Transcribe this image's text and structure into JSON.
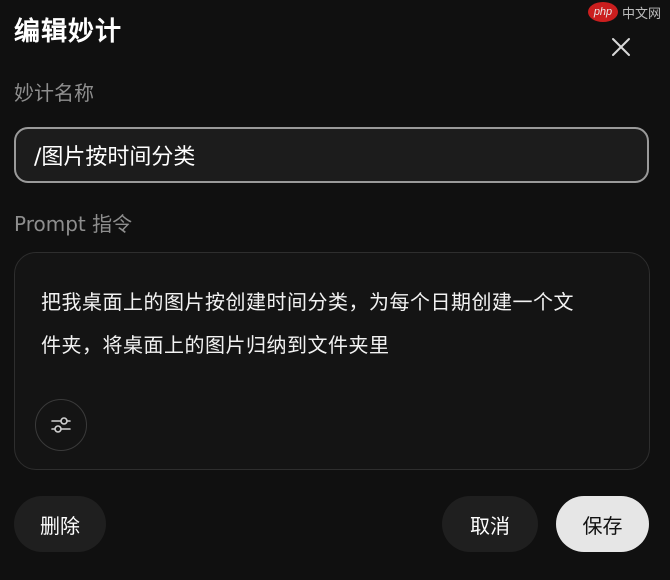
{
  "dialog": {
    "title": "编辑妙计"
  },
  "watermark": {
    "badge": "php",
    "text": "中文网"
  },
  "name_field": {
    "label": "妙计名称",
    "value": "/图片按时间分类"
  },
  "prompt_field": {
    "label": "Prompt 指令",
    "line1": "把我桌面上的图片按创建时间分类，为每个日期创建一个文",
    "line2": "件夹，将桌面上的图片归纳到文件夹里"
  },
  "actions": {
    "delete_label": "删除",
    "cancel_label": "取消",
    "save_label": "保存"
  },
  "icons": {
    "close": "close-icon",
    "settings": "sliders-icon"
  },
  "colors": {
    "background": "#101010",
    "input_border": "#9a9a9a",
    "label": "#8e8e8e",
    "save_bg": "#e6e6e6",
    "secondary_bg": "#1f1f1f"
  }
}
